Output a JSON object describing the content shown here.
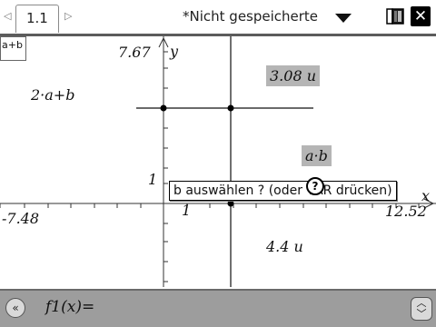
{
  "topbar": {
    "tab_label": "1.1",
    "document_title": "*Nicht gespeicherte"
  },
  "graph": {
    "y_max_label": "7.67",
    "x_min_label": "-7.48",
    "x_max_label": "12.52",
    "y_axis_name": "y",
    "x_axis_name": "x",
    "tick_label_y": "1",
    "tick_label_x": "1",
    "expression_1": "2·a+b",
    "expression_2": "a·b",
    "measurement_1": "3.08 u",
    "measurement_2": "4.4 u",
    "tag_box_label": "a+b"
  },
  "tooltip": {
    "text": "b auswählen ? (oder VAR drücken)"
  },
  "entry_line": {
    "function_label": "f1(x)="
  },
  "colors": {
    "accent": "#5c5c5c",
    "entry_bar": "#9d9d9d",
    "shade": "#b5b5b5"
  }
}
